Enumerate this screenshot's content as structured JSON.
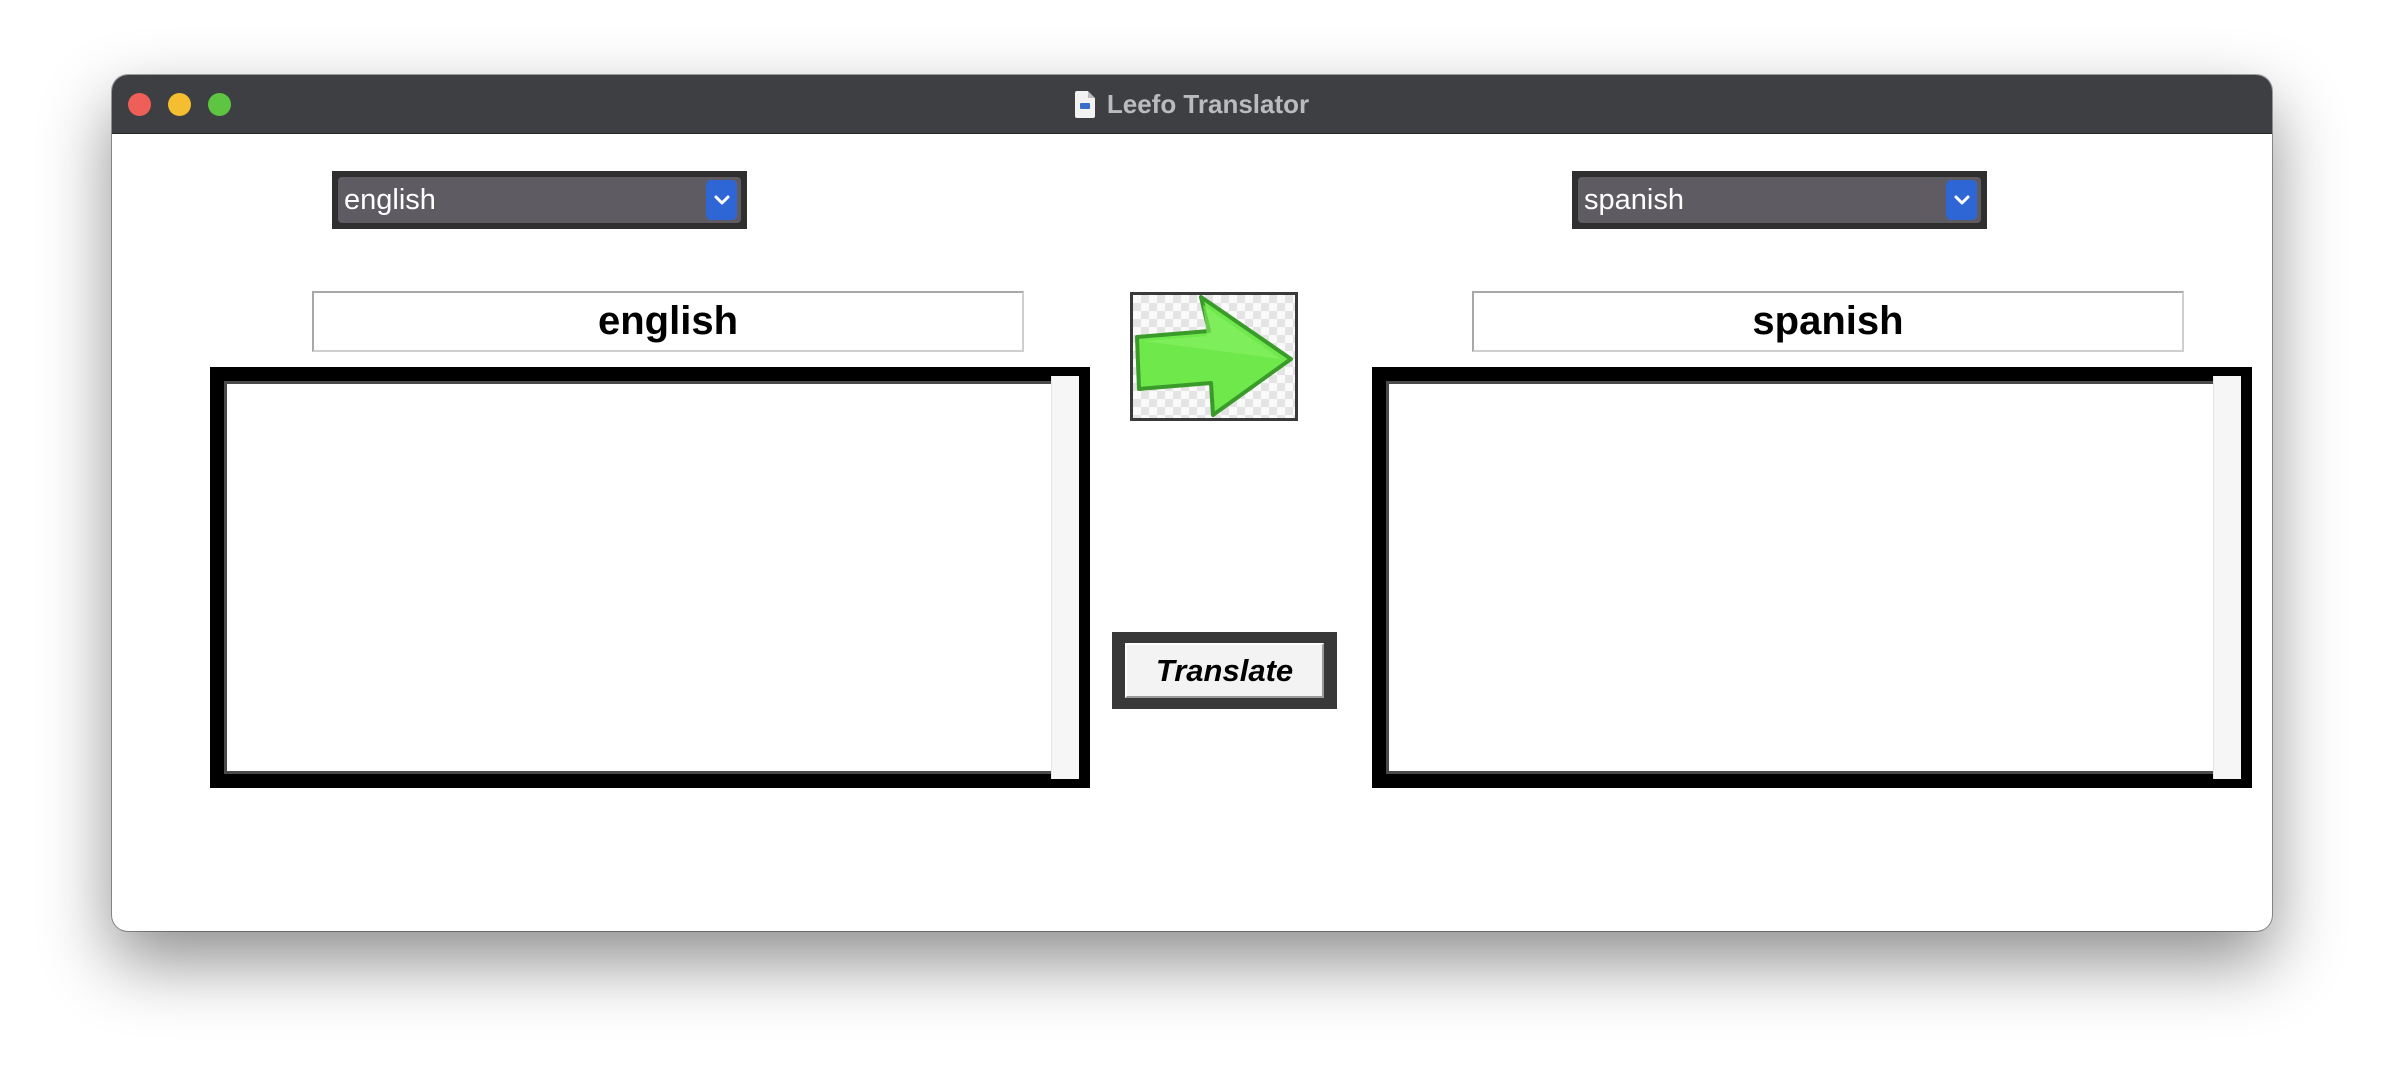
{
  "window": {
    "title": "Leefo Translator"
  },
  "source": {
    "selected_language": "english",
    "label": "english",
    "text": ""
  },
  "target": {
    "selected_language": "spanish",
    "label": "spanish",
    "text": ""
  },
  "actions": {
    "translate_label": "Translate"
  },
  "icons": {
    "arrow": "green-right-arrow-icon",
    "chevron": "chevron-down-icon",
    "document": "document-icon"
  },
  "colors": {
    "titlebar": "#3d3f42",
    "select_bg": "#5e5c62",
    "select_accent": "#2f66d6",
    "arrow_fill": "#6ee84a",
    "arrow_stroke": "#3a9a2a"
  }
}
